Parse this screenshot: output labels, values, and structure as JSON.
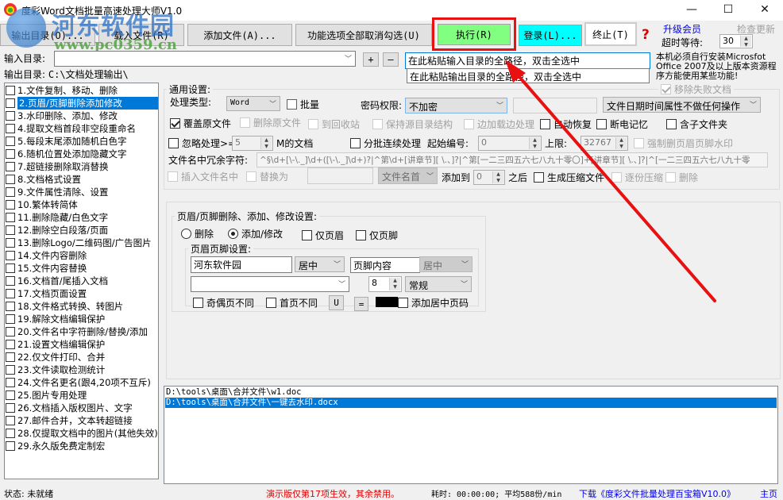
{
  "window": {
    "title": "度彩Word文档批量高速处理大师V1.0",
    "controls": {
      "minimize": "—",
      "maximize": "☐",
      "close": "✕"
    }
  },
  "watermark": {
    "name": "河东软件园",
    "url": "www.pc0359.cn"
  },
  "toolbar": {
    "output_dir": "输出目录(O)...",
    "load_files": "载入文件(R)",
    "add_files": "添加文件(A)...",
    "toggle_all": "功能选项全部取消勾选(U)",
    "execute": "执行(R)",
    "login": "登录(L)...",
    "stop": "终止(T)",
    "help": "?",
    "upgrade": "升级会员",
    "check_update": "检查更新",
    "timeout_label": "超时等待:",
    "timeout_value": "30"
  },
  "paths": {
    "input_label": "输入目录:",
    "input_value": "",
    "add": "+",
    "remove": "—",
    "output_label": "输出目录:",
    "output_value": "C:\\文档处理输出\\",
    "input_paste_hint": "在此粘贴输入目录的全路径，双击全选中",
    "output_paste_hint": "在此粘贴输出目录的全路径，双击全选中",
    "notice": "本机必须自行安装Microsfot Office 2007及以上版本资源程序方能使用某些功能!"
  },
  "features": [
    {
      "label": "1.文件复制、移动、删除",
      "checked": false
    },
    {
      "label": "2.页眉/页脚删除添加修改",
      "checked": false,
      "selected": true
    },
    {
      "label": "3.水印删除、添加、修改",
      "checked": false
    },
    {
      "label": "4.提取文档首段非空段重命名",
      "checked": false
    },
    {
      "label": "5.每段末尾添加随机白色字",
      "checked": false
    },
    {
      "label": "6.随机位置处添加隐藏文字",
      "checked": false
    },
    {
      "label": "7.超链接删除取消替换",
      "checked": false
    },
    {
      "label": "8.文档格式设置",
      "checked": false
    },
    {
      "label": "9.文件属性清除、设置",
      "checked": false
    },
    {
      "label": "10.繁体转简体",
      "checked": false
    },
    {
      "label": "11.删除隐藏/白色文字",
      "checked": false
    },
    {
      "label": "12.删除空白段落/页面",
      "checked": false
    },
    {
      "label": "13.删除Logo/二维码图/广告图片",
      "checked": false
    },
    {
      "label": "14.文件内容删除",
      "checked": false
    },
    {
      "label": "15.文件内容替换",
      "checked": false
    },
    {
      "label": "16.文档首/尾插入文档",
      "checked": false
    },
    {
      "label": "17.文档页面设置",
      "checked": false
    },
    {
      "label": "18.文件格式转换、转图片",
      "checked": false
    },
    {
      "label": "19.解除文档编辑保护",
      "checked": false
    },
    {
      "label": "20.文件名中字符删除/替换/添加",
      "checked": false
    },
    {
      "label": "21.设置文档编辑保护",
      "checked": false
    },
    {
      "label": "22.仅文件打印、合并",
      "checked": false
    },
    {
      "label": "23.文件读取检测统计",
      "checked": false
    },
    {
      "label": "24.文件名更名(跟4,20项不互斥)",
      "checked": false
    },
    {
      "label": "25.图片专用处理",
      "checked": false
    },
    {
      "label": "26.文档插入版权图片、文字",
      "checked": false
    },
    {
      "label": "27.邮件合并，文本转超链接",
      "checked": false
    },
    {
      "label": "28.仅提取文档中的图片(其他失效)",
      "checked": false
    },
    {
      "label": "29.永久版免费定制宏",
      "checked": false
    }
  ],
  "general": {
    "title": "通用设置:",
    "remove_failed": "移除失败文档",
    "type_label": "处理类型:",
    "type_value": "Word",
    "batch": "批量",
    "password_label": "密码权限:",
    "password_value": "不加密",
    "password_extra": "",
    "date_attr": "文件日期时间属性不做任何操作",
    "overwrite": "覆盖原文件",
    "delete_original": "删除原文件",
    "recycle": "到回收站",
    "keep_structure": "保持源目录结构",
    "load_process": "边加载边处理",
    "auto_restore": "自动恢复",
    "power_memory": "断电记忆",
    "include_sub": "含子文件夹",
    "ignore_label": "忽略处理>=",
    "ignore_value": "5",
    "ignore_unit": "M的文档",
    "batch_continuous": "分批连续处理",
    "start_label": "起始编号:",
    "start_value": "0",
    "limit_label": "上限:",
    "limit_value": "32767",
    "force_delete": "强制删页眉页脚水印",
    "redundant_label": "文件名中冗余字符:",
    "redundant_value": "^§\\d+[\\-\\._]\\d+([\\-\\._]\\d+)?|^第\\d+[讲章节][ \\.、]?|^第[一二三四五六七八九十零〇]+[讲章节][ \\.、]?|^[一二三四五六七八九十零",
    "insert_filename": "插入文件名中",
    "replace_with": "替换为",
    "replace_value": "",
    "position_value": "文件名首",
    "add_to_label": "添加到",
    "add_to_value": "0",
    "after_label": "之后",
    "gen_zip": "生成压缩文件",
    "zip_each": "逐份压缩",
    "zip_delete": "删除"
  },
  "header_footer": {
    "title": "页眉/页脚删除、添加、修改设置:",
    "delete": "删除",
    "add_modify": "添加/修改",
    "header_only": "仅页眉",
    "footer_only": "仅页脚",
    "settings_title": "页眉页脚设置:",
    "header_text": "河东软件园",
    "header_align": "居中",
    "footer_text": "页脚内容",
    "footer_align": "居中",
    "font_value": "",
    "size_value": "8",
    "style_value": "常规",
    "odd_even": "奇偶页不同",
    "first_page": "首页不同",
    "underline_btn": "U",
    "equal_btn": "=",
    "color_swatch": "#000000",
    "add_page_num": "添加居中页码"
  },
  "files": [
    {
      "path": "D:\\tools\\桌面\\合并文件\\w1.doc",
      "selected": false
    },
    {
      "path": "D:\\tools\\桌面\\合并文件\\一键去水印.docx",
      "selected": true
    }
  ],
  "statusbar": {
    "status": "状态: 未就绪",
    "demo_notice": "演示版仅第17项生效，其余禁用。",
    "elapsed": "耗时: 00:00:00; 平均588份/min",
    "download_link": "下载《度彩文件批量处理百宝箱V10.0》",
    "home": "主页"
  },
  "colors": {
    "execute_bg": "#80ff80",
    "login_bg": "#00ffff",
    "highlight_red": "#e81010",
    "selection_blue": "#0078d7",
    "link_blue": "#0000ee",
    "demo_red": "#e00000"
  }
}
